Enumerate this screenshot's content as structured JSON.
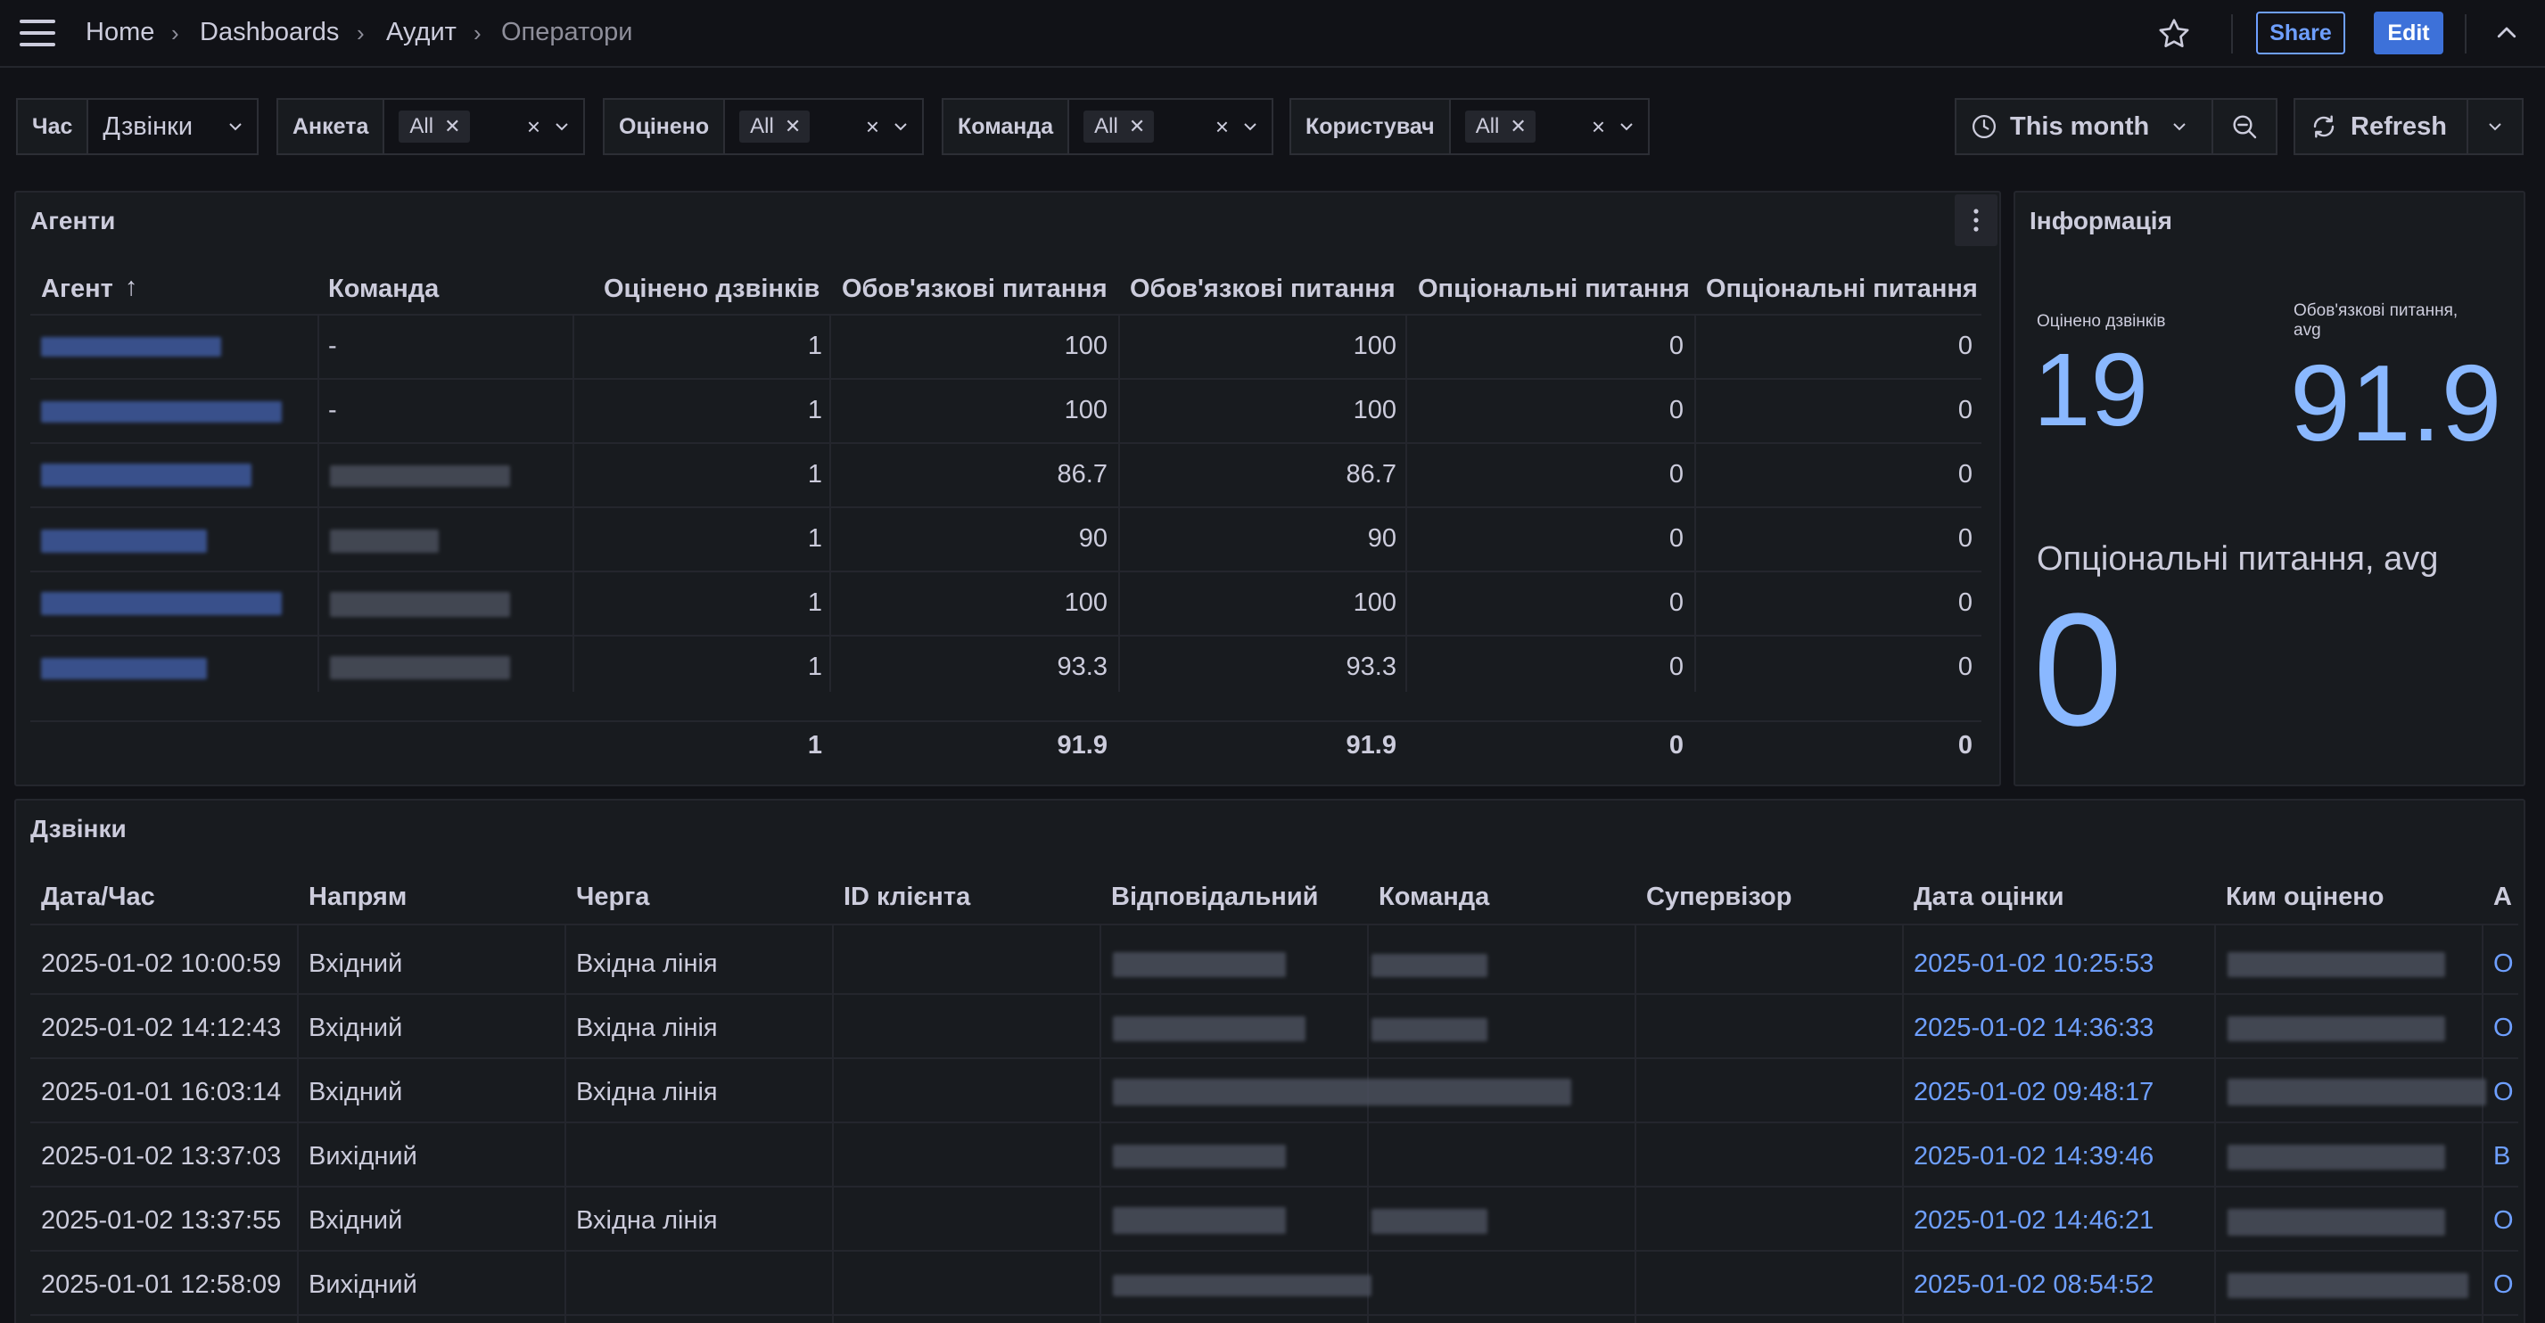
{
  "breadcrumb": {
    "items": [
      "Home",
      "Dashboards",
      "Аудит",
      "Оператори"
    ]
  },
  "header": {
    "share_label": "Share",
    "edit_label": "Edit"
  },
  "variables": [
    {
      "label": "Час",
      "value": "Дзвінки"
    },
    {
      "label": "Анкета",
      "value": "All"
    },
    {
      "label": "Оцінено",
      "value": "All"
    },
    {
      "label": "Команда",
      "value": "All"
    },
    {
      "label": "Користувач",
      "value": "All"
    }
  ],
  "time_picker": {
    "label": "This month"
  },
  "refresh": {
    "label": "Refresh"
  },
  "agents_panel": {
    "title": "Агенти",
    "columns": [
      "Агент",
      "Команда",
      "Оцінено дзвінків",
      "Обов'язкові питання",
      "Обов'язкові питання",
      "Опціональні питання",
      "Опціональні питання"
    ],
    "rows": [
      {
        "team": "-",
        "calls": "1",
        "m1": "100",
        "m2": "100",
        "o1": "0",
        "o2": "0"
      },
      {
        "team": "-",
        "calls": "1",
        "m1": "100",
        "m2": "100",
        "o1": "0",
        "o2": "0"
      },
      {
        "team": "",
        "calls": "1",
        "m1": "86.7",
        "m2": "86.7",
        "o1": "0",
        "o2": "0"
      },
      {
        "team": "",
        "calls": "1",
        "m1": "90",
        "m2": "90",
        "o1": "0",
        "o2": "0"
      },
      {
        "team": "",
        "calls": "1",
        "m1": "100",
        "m2": "100",
        "o1": "0",
        "o2": "0"
      },
      {
        "team": "",
        "calls": "1",
        "m1": "93.3",
        "m2": "93.3",
        "o1": "0",
        "o2": "0"
      }
    ],
    "footer": {
      "calls": "1",
      "m1": "91.9",
      "m2": "91.9",
      "o1": "0",
      "o2": "0"
    }
  },
  "info_panel": {
    "title": "Інформація",
    "stat1": {
      "label": "Оцінено дзвінків",
      "value": "19"
    },
    "stat2": {
      "label_line1": "Обов'язкові питання,",
      "label_line2": "avg",
      "value": "91.9"
    },
    "stat3": {
      "label": "Опціональні питання, avg",
      "value": "0"
    }
  },
  "calls_panel": {
    "title": "Дзвінки",
    "columns": [
      "Дата/Час",
      "Напрям",
      "Черга",
      "ID клієнта",
      "Відповідальний",
      "Команда",
      "Супервізор",
      "Дата оцінки",
      "Ким оцінено",
      "А"
    ],
    "rows": [
      {
        "datetime": "2025-01-02 10:00:59",
        "direction": "Вхідний",
        "queue": "Вхідна лінія",
        "eval_date": "2025-01-02 10:25:53",
        "last": "О"
      },
      {
        "datetime": "2025-01-02 14:12:43",
        "direction": "Вхідний",
        "queue": "Вхідна лінія",
        "eval_date": "2025-01-02 14:36:33",
        "last": "О"
      },
      {
        "datetime": "2025-01-01 16:03:14",
        "direction": "Вхідний",
        "queue": "Вхідна лінія",
        "eval_date": "2025-01-02 09:48:17",
        "last": "О"
      },
      {
        "datetime": "2025-01-02 13:37:03",
        "direction": "Вихідний",
        "queue": "",
        "eval_date": "2025-01-02 14:39:46",
        "last": "В"
      },
      {
        "datetime": "2025-01-02 13:37:55",
        "direction": "Вхідний",
        "queue": "Вхідна лінія",
        "eval_date": "2025-01-02 14:46:21",
        "last": "О"
      },
      {
        "datetime": "2025-01-01 12:58:09",
        "direction": "Вихідний",
        "queue": "",
        "eval_date": "2025-01-02 08:54:52",
        "last": "О"
      }
    ]
  }
}
